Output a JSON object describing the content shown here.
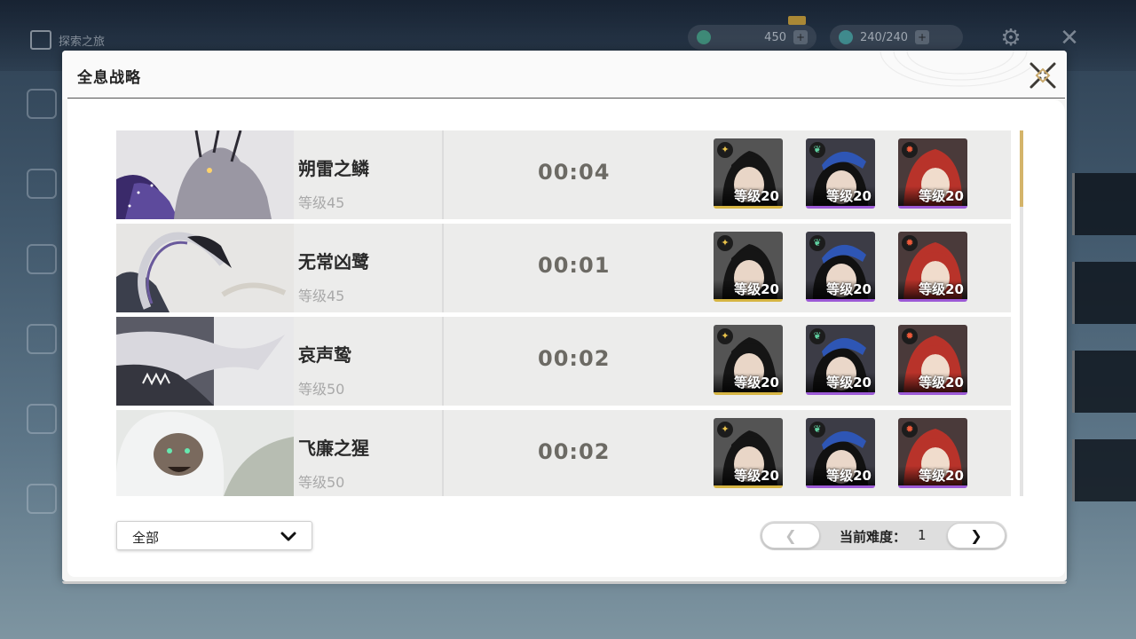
{
  "background": {
    "home_label": "探索之旅",
    "currency_value": "450",
    "stamina_value": "240/240"
  },
  "modal": {
    "title": "全息战略"
  },
  "bosses": [
    {
      "name": "朔雷之鳞",
      "level": "等级45",
      "time": "00:04",
      "team": [
        {
          "level": "等级20",
          "element": "spectro-icon"
        },
        {
          "level": "等级20",
          "element": "aero-icon"
        },
        {
          "level": "等级20",
          "element": "fusion-icon"
        }
      ]
    },
    {
      "name": "无常凶鹭",
      "level": "等级45",
      "time": "00:01",
      "team": [
        {
          "level": "等级20",
          "element": "spectro-icon"
        },
        {
          "level": "等级20",
          "element": "aero-icon"
        },
        {
          "level": "等级20",
          "element": "fusion-icon"
        }
      ]
    },
    {
      "name": "哀声鸷",
      "level": "等级50",
      "time": "00:02",
      "team": [
        {
          "level": "等级20",
          "element": "spectro-icon"
        },
        {
          "level": "等级20",
          "element": "aero-icon"
        },
        {
          "level": "等级20",
          "element": "fusion-icon"
        }
      ]
    },
    {
      "name": "飞廉之猩",
      "level": "等级50",
      "time": "00:02",
      "team": [
        {
          "level": "等级20",
          "element": "spectro-icon"
        },
        {
          "level": "等级20",
          "element": "aero-icon"
        },
        {
          "level": "等级20",
          "element": "fusion-icon"
        }
      ]
    }
  ],
  "footer": {
    "filter_label": "全部",
    "difficulty_label": "当前难度：",
    "difficulty_value": "1",
    "prev_symbol": "❮",
    "next_symbol": "❯"
  },
  "colors": {
    "accent_gold": "#d6b543",
    "rarity_purple": "#9c5ad6",
    "time_text": "#6c6a64"
  }
}
